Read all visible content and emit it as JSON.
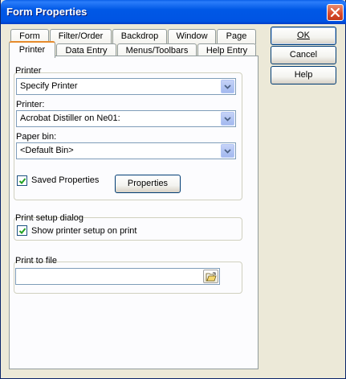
{
  "window": {
    "title": "Form Properties"
  },
  "tabs_back": [
    {
      "label": "Form"
    },
    {
      "label": "Filter/Order"
    },
    {
      "label": "Backdrop"
    },
    {
      "label": "Window"
    },
    {
      "label": "Page"
    }
  ],
  "tabs_front": [
    {
      "label": "Printer"
    },
    {
      "label": "Data Entry"
    },
    {
      "label": "Menus/Toolbars"
    },
    {
      "label": "Help Entry"
    }
  ],
  "printer_group": {
    "title": "Printer",
    "select_value": "Specify Printer",
    "printer_label": "Printer:",
    "printer_value": "Acrobat Distiller on Ne01:",
    "paperbin_label": "Paper bin:",
    "paperbin_value": "<Default Bin>",
    "saved_props_label": "Saved Properties",
    "saved_props_checked": true,
    "properties_button": "Properties"
  },
  "print_setup_group": {
    "title": "Print setup dialog",
    "show_setup_label": "Show printer setup on print",
    "show_setup_checked": true
  },
  "print_to_file_group": {
    "title": "Print to file",
    "value": ""
  },
  "buttons": {
    "ok": "OK",
    "cancel": "Cancel",
    "help": "Help"
  }
}
